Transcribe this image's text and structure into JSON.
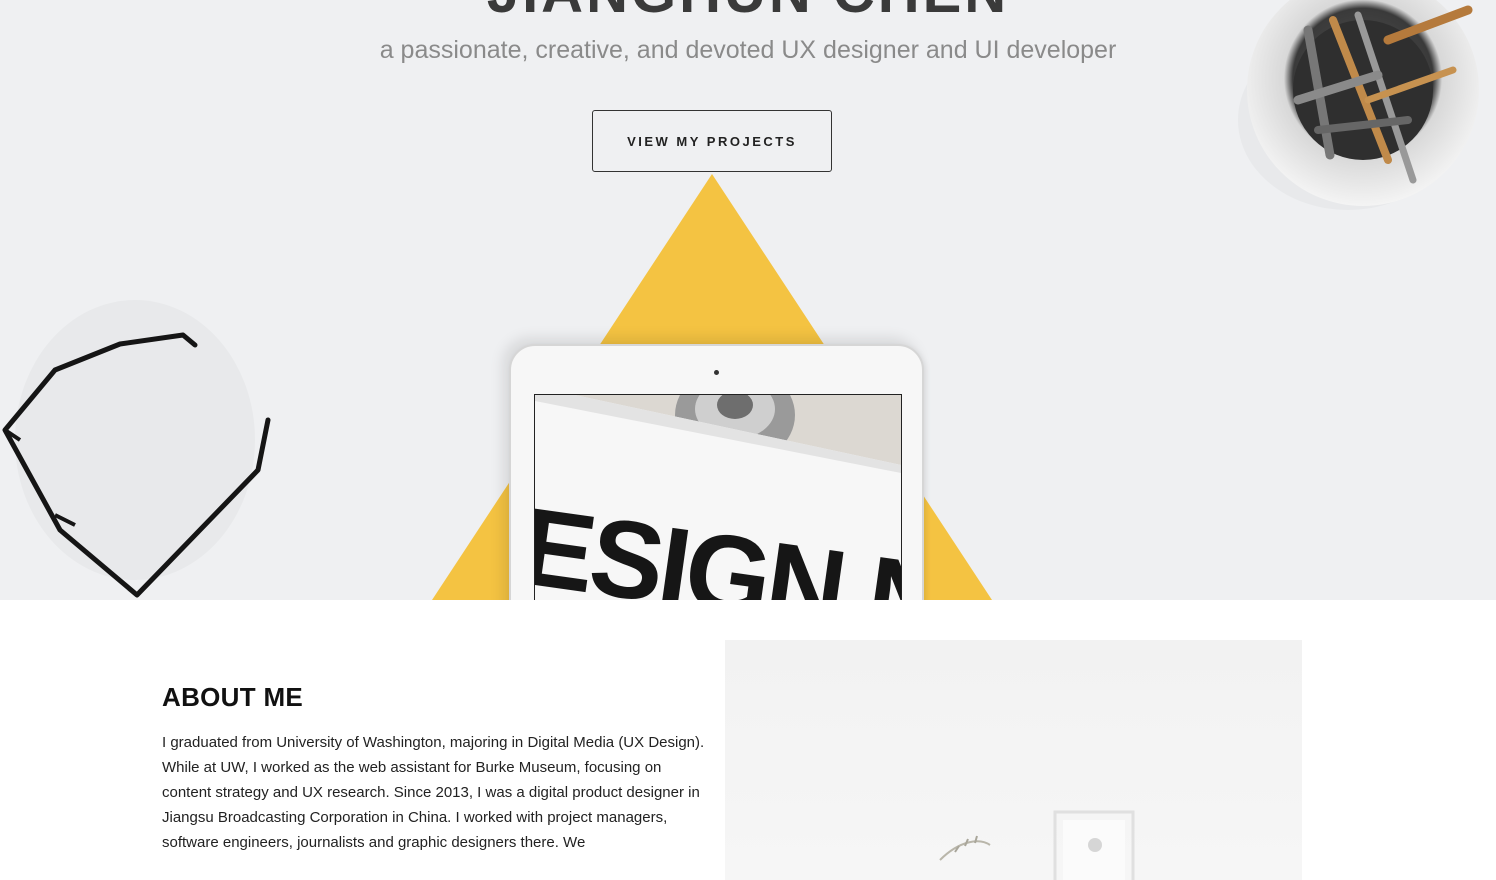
{
  "hero": {
    "name": "JIANGHUN CHEN",
    "tagline": "a passionate, creative, and devoted UX designer and UI developer",
    "cta_label": "VIEW MY PROJECTS",
    "tablet_screen_text": "ESIGN N",
    "accent_color": "#f4c342",
    "background_color": "#eff0f2"
  },
  "about": {
    "title": "ABOUT ME",
    "paragraph": "I graduated from University of Washington, majoring in Digital Media (UX Design). While at UW, I worked as the web assistant for Burke Museum, focusing on content strategy and UX research. Since 2013, I was a digital product designer in Jiangsu Broadcasting Corporation in China. I worked with project managers, software engineers, journalists and graphic designers there. We"
  }
}
